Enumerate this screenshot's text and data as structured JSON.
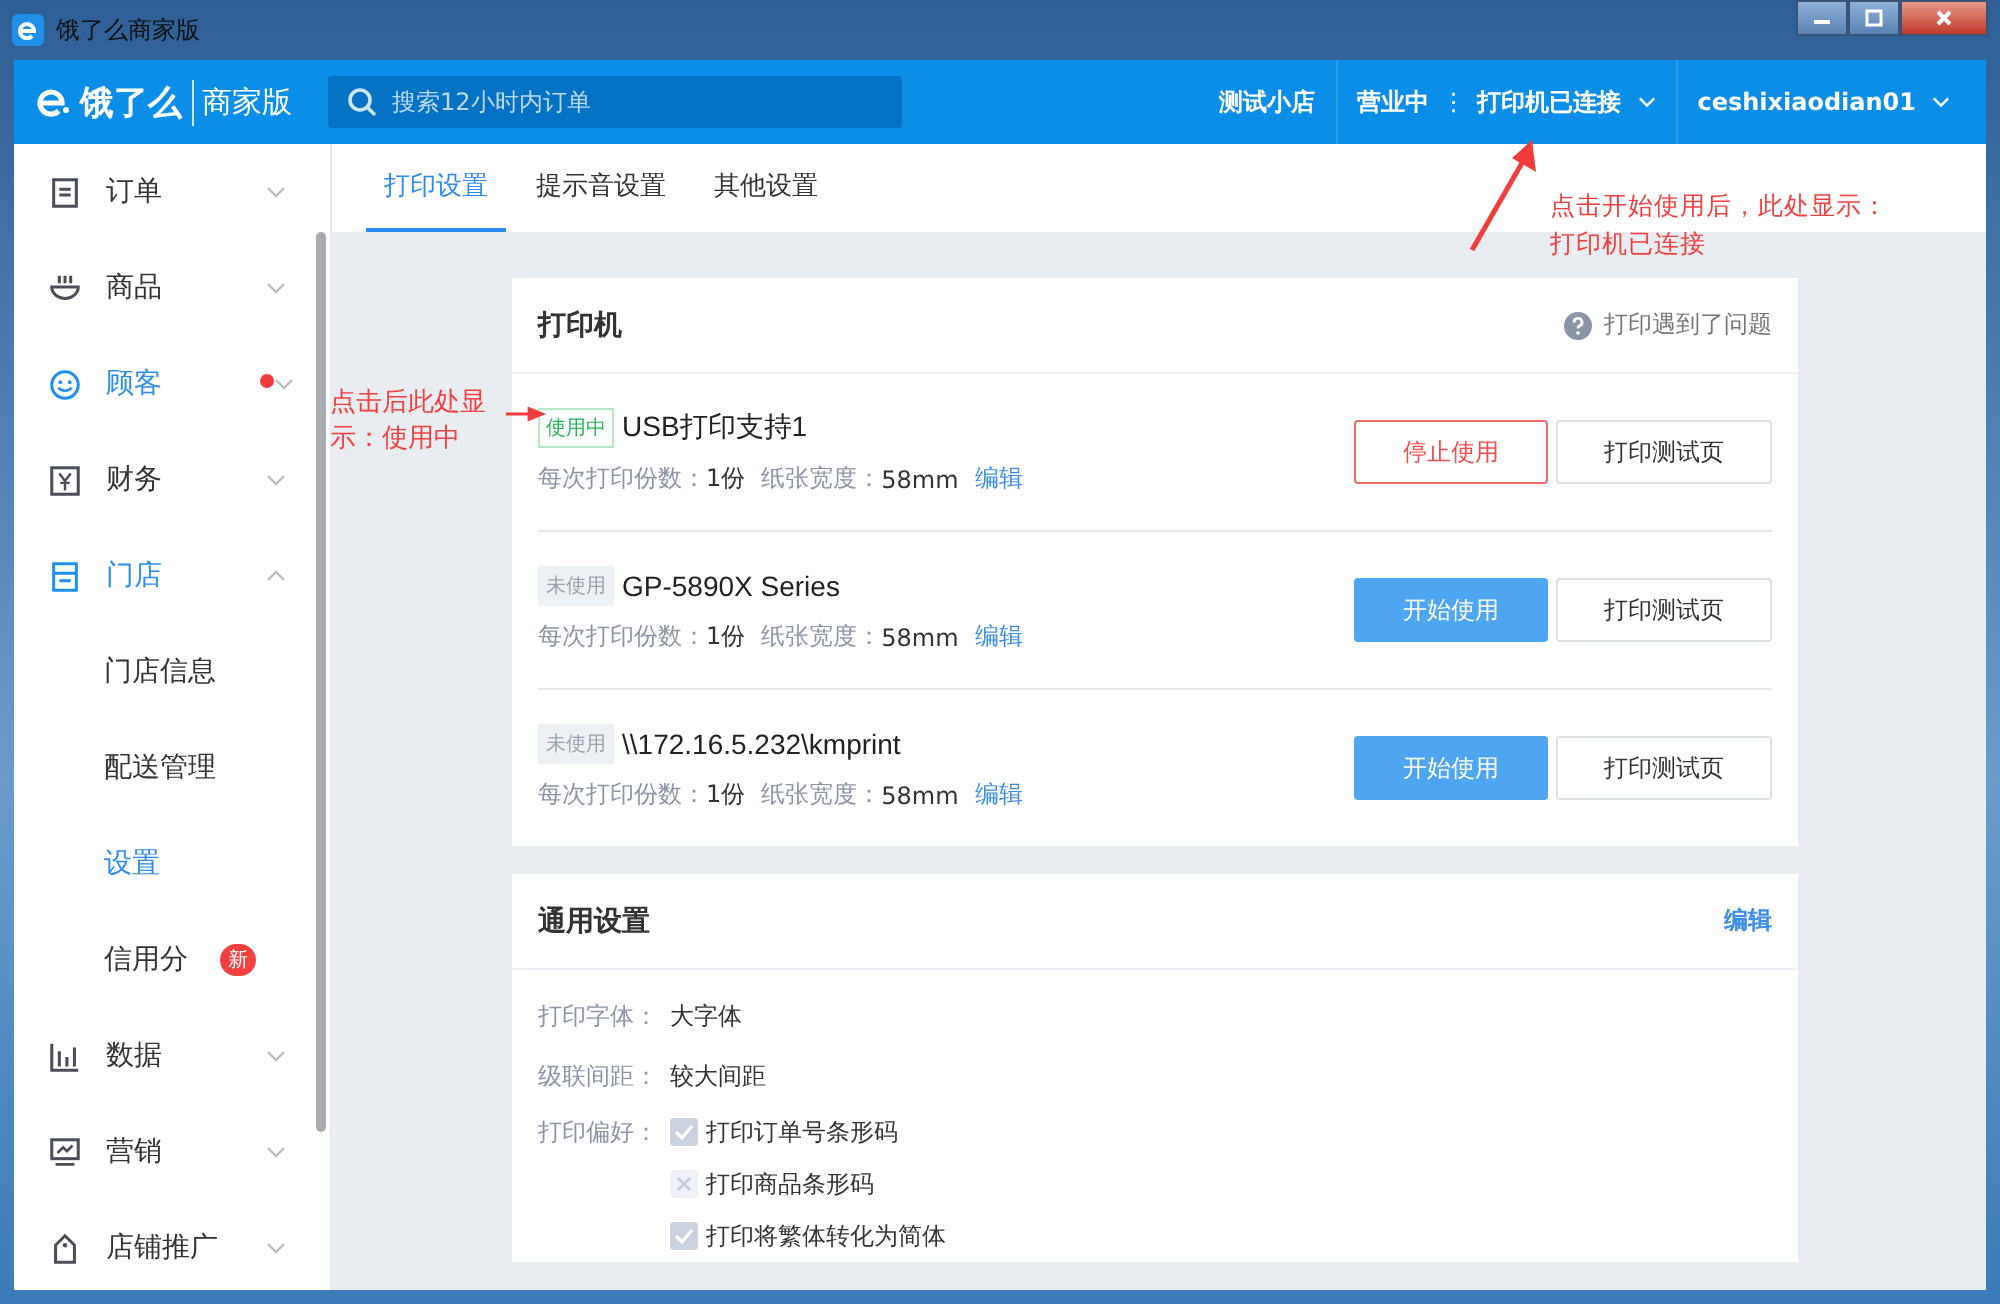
{
  "window": {
    "title": "饿了么商家版"
  },
  "header": {
    "logo": "饿了么",
    "edition": "商家版",
    "search": {
      "placeholder": "搜索12小时内订单"
    },
    "shop": "测试小店",
    "status": "营业中",
    "separator": "⋮",
    "printer_status": "打印机已连接",
    "user": "ceshixiaodian01"
  },
  "sidebar": {
    "items": [
      {
        "label": "订单",
        "active": false,
        "expanded": false,
        "dot": false
      },
      {
        "label": "商品",
        "active": false,
        "expanded": false,
        "dot": false
      },
      {
        "label": "顾客",
        "active": true,
        "expanded": false,
        "dot": true
      },
      {
        "label": "财务",
        "active": false,
        "expanded": false,
        "dot": false
      },
      {
        "label": "门店",
        "active": true,
        "expanded": true,
        "dot": false,
        "children": [
          {
            "label": "门店信息",
            "selected": false
          },
          {
            "label": "配送管理",
            "selected": false
          },
          {
            "label": "设置",
            "selected": true
          },
          {
            "label": "信用分",
            "selected": false,
            "badge": "新"
          }
        ]
      },
      {
        "label": "数据",
        "active": false,
        "expanded": false,
        "dot": false
      },
      {
        "label": "营销",
        "active": false,
        "expanded": false,
        "dot": false
      },
      {
        "label": "店铺推广",
        "active": false,
        "expanded": false,
        "dot": false
      }
    ]
  },
  "tabs": [
    {
      "label": "打印设置",
      "selected": true
    },
    {
      "label": "提示音设置",
      "selected": false
    },
    {
      "label": "其他设置",
      "selected": false
    }
  ],
  "printers_card": {
    "title": "打印机",
    "help": "打印遇到了问题",
    "printers": [
      {
        "status": "使用中",
        "in_use": true,
        "name": "USB打印支持1",
        "copies_label": "每次打印份数：",
        "copies": "1份",
        "width_label": "纸张宽度：",
        "width": "58mm",
        "edit": "编辑",
        "action": "停止使用",
        "test": "打印测试页"
      },
      {
        "status": "未使用",
        "in_use": false,
        "name": "GP-5890X Series",
        "copies_label": "每次打印份数：",
        "copies": "1份",
        "width_label": "纸张宽度：",
        "width": "58mm",
        "edit": "编辑",
        "action": "开始使用",
        "test": "打印测试页"
      },
      {
        "status": "未使用",
        "in_use": false,
        "name": "\\\\172.16.5.232\\kmprint",
        "copies_label": "每次打印份数：",
        "copies": "1份",
        "width_label": "纸张宽度：",
        "width": "58mm",
        "edit": "编辑",
        "action": "开始使用",
        "test": "打印测试页"
      }
    ]
  },
  "general_card": {
    "title": "通用设置",
    "edit": "编辑",
    "fields": [
      {
        "label": "打印字体：",
        "value": "大字体"
      },
      {
        "label": "级联间距：",
        "value": "较大间距"
      }
    ],
    "preferences": {
      "label": "打印偏好：",
      "options": [
        {
          "label": "打印订单号条形码",
          "checked": true
        },
        {
          "label": "打印商品条形码",
          "checked": false
        },
        {
          "label": "打印将繁体转化为简体",
          "checked": true
        }
      ]
    }
  },
  "annotations": [
    {
      "text": "点击开始使用后，此处显示：打印机已连接"
    },
    {
      "text": "点击后此处显示：使用中"
    }
  ]
}
